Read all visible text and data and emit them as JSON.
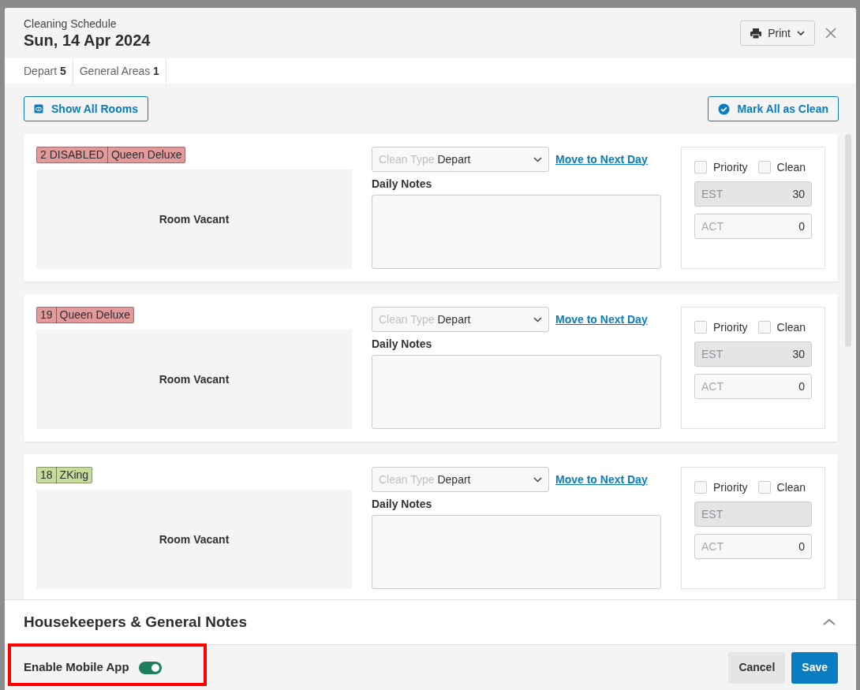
{
  "header": {
    "subtitle": "Cleaning Schedule",
    "title": "Sun, 14 Apr 2024",
    "print_button": "Print"
  },
  "tabs": [
    {
      "label": "Depart",
      "count": "5"
    },
    {
      "label": "General Areas",
      "count": "1"
    }
  ],
  "actions": {
    "show_all": "Show All Rooms",
    "mark_all": "Mark All as Clean"
  },
  "rooms": [
    {
      "number": "2 DISABLED",
      "type": "Queen Deluxe",
      "color": "#e39a9a",
      "status": "Room Vacant",
      "clean_type_placeholder": "Clean Type",
      "clean_type": "Depart",
      "move_link": "Move to Next Day",
      "notes_label": "Daily Notes",
      "priority": {
        "label": "Priority",
        "checked": false
      },
      "clean": {
        "label": "Clean",
        "checked": false
      },
      "est": {
        "placeholder": "EST",
        "value": "30"
      },
      "act": {
        "placeholder": "ACT",
        "value": "0"
      }
    },
    {
      "number": "19",
      "type": "Queen Deluxe",
      "color": "#e39a9a",
      "status": "Room Vacant",
      "clean_type_placeholder": "Clean Type",
      "clean_type": "Depart",
      "move_link": "Move to Next Day",
      "notes_label": "Daily Notes",
      "priority": {
        "label": "Priority",
        "checked": false
      },
      "clean": {
        "label": "Clean",
        "checked": false
      },
      "est": {
        "placeholder": "EST",
        "value": "30"
      },
      "act": {
        "placeholder": "ACT",
        "value": "0"
      }
    },
    {
      "number": "18",
      "type": "ZKing",
      "color": "#c5dc9a",
      "status": "Room Vacant",
      "clean_type_placeholder": "Clean Type",
      "clean_type": "Depart",
      "move_link": "Move to Next Day",
      "notes_label": "Daily Notes",
      "priority": {
        "label": "Priority",
        "checked": false
      },
      "clean": {
        "label": "Clean",
        "checked": false
      },
      "est": {
        "placeholder": "EST"
      },
      "act": {
        "placeholder": "ACT",
        "value": "0"
      }
    }
  ],
  "housekeepers": {
    "title": "Housekeepers & General Notes",
    "expanded": true
  },
  "footer": {
    "mobile_app": {
      "label": "Enable Mobile App",
      "on": true
    },
    "cancel": "Cancel",
    "save": "Save"
  }
}
